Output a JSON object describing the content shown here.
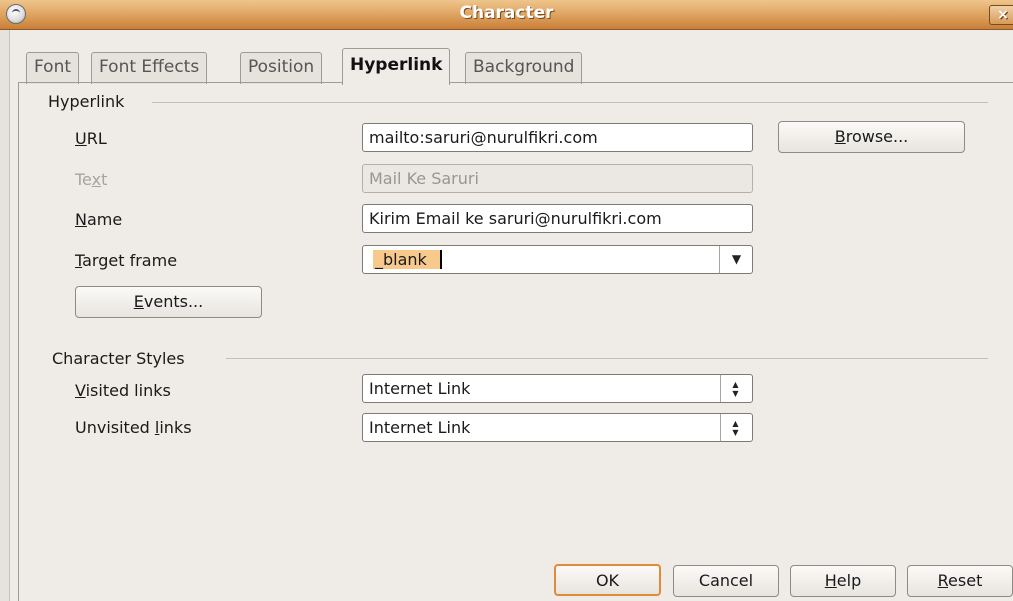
{
  "window": {
    "title": "Character",
    "close_glyph": "×",
    "icon": "app-icon"
  },
  "tabs": [
    {
      "label": "Font",
      "active": false
    },
    {
      "label": "Font Effects",
      "active": false
    },
    {
      "label": "Position",
      "active": false
    },
    {
      "label": "Hyperlink",
      "active": true
    },
    {
      "label": "Background",
      "active": false
    }
  ],
  "hyperlink": {
    "section_title": "Hyperlink",
    "url_label_pre": "",
    "url_label_key": "U",
    "url_label_post": "RL",
    "url_value": "mailto:saruri@nurulfikri.com",
    "browse_key": "B",
    "browse_post": "rowse...",
    "text_label_pre": "Te",
    "text_label_key": "x",
    "text_label_post": "t",
    "text_value": "Mail Ke Saruri",
    "name_label_key": "N",
    "name_label_post": "ame",
    "name_value": "Kirim Email ke saruri@nurulfikri.com",
    "target_label_key": "T",
    "target_label_post": "arget frame",
    "target_value": "_blank",
    "events_key": "E",
    "events_post": "vents..."
  },
  "character_styles": {
    "section_title": "Character Styles",
    "visited_label_key": "V",
    "visited_label_post": "isited links",
    "visited_value": "Internet Link",
    "unvisited_label_pre": "Unvisited ",
    "unvisited_label_key": "l",
    "unvisited_label_post": "inks",
    "unvisited_value": "Internet Link"
  },
  "footer": {
    "ok": "OK",
    "cancel": "Cancel",
    "help_key": "H",
    "help_post": "elp",
    "reset_key": "R",
    "reset_post": "eset"
  },
  "colors": {
    "title_bar": "#dca05c",
    "dialog_bg": "#efebe7",
    "default_button_border": "#e38a3a",
    "selection": "#f8c98c"
  }
}
